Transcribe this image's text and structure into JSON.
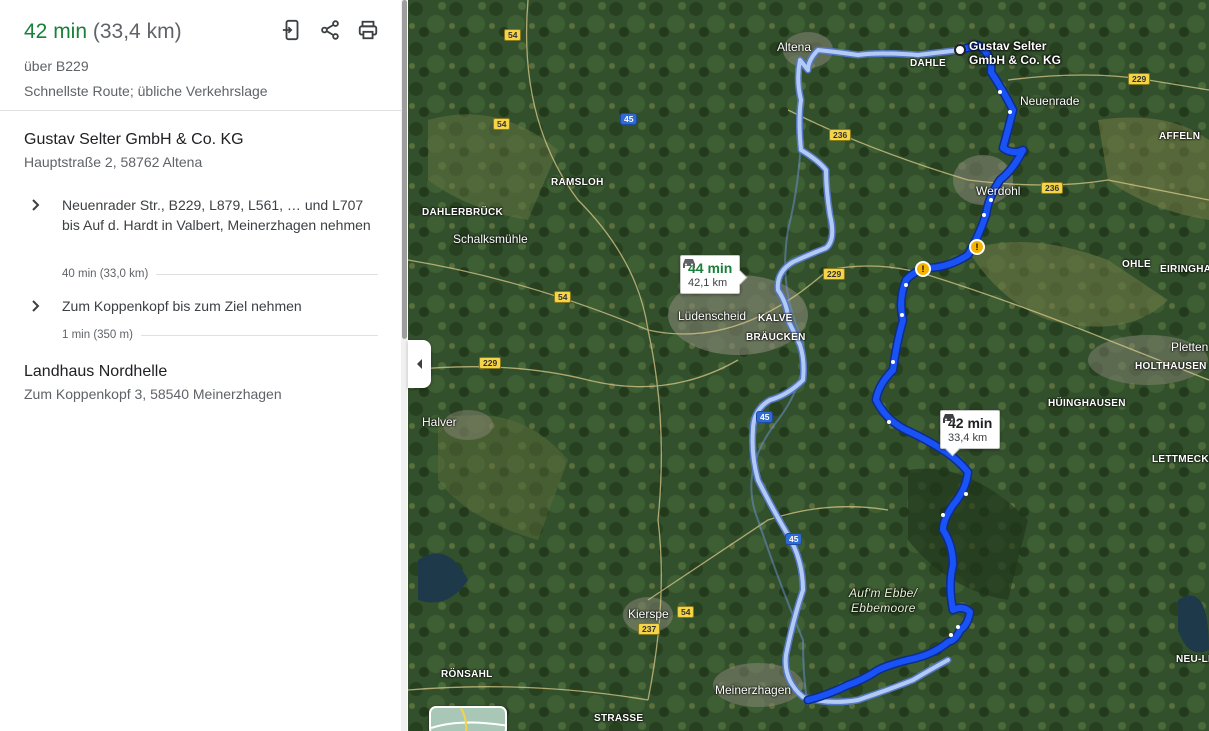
{
  "summary": {
    "duration": "42 min",
    "distance": "(33,4 km)",
    "via": "über B229",
    "note": "Schnellste Route; übliche Verkehrslage",
    "tools": [
      "send-to-phone-icon",
      "share-icon",
      "print-icon"
    ]
  },
  "origin": {
    "name": "Gustav Selter GmbH & Co. KG",
    "address": "Hauptstraße 2, 58762 Altena"
  },
  "steps": [
    {
      "text": "Neuenrader Str., B229, L879, L561, … und L707 bis Auf d. Hardt in Valbert, Meinerzhagen nehmen",
      "meta": "40 min (33,0 km)"
    },
    {
      "text": "Zum Koppenkopf bis zum Ziel nehmen",
      "meta": "1 min (350 m)"
    }
  ],
  "destination": {
    "name": "Landhaus Nordhelle",
    "address": "Zum Koppenkopf 3, 58540 Meinerzhagen"
  },
  "map": {
    "main_route": {
      "time": "42 min",
      "dist": "33,4 km"
    },
    "alt_route": {
      "time": "44 min",
      "dist": "42,1 km"
    },
    "dest_label_line1": "Gustav Selter",
    "dest_label_line2": "GmbH & Co. KG",
    "places": {
      "altena": "Altena",
      "dahle": "DAHLE",
      "neuenrade": "Neuenrade",
      "affeln": "AFFELN",
      "werdohl": "Werdohl",
      "ramsloh": "RAMSLOH",
      "dahlerbruck": "DAHLERBRÜCK",
      "schalksmuehle": "Schalksmühle",
      "ohle": "OHLE",
      "eiringhausen": "EIRINGHA",
      "luedenscheid": "Lüdenscheid",
      "kalve": "KALVE",
      "braecken": "BRÄUCKEN",
      "plettenberg": "Pletten",
      "holthausen": "HOLTHAUSEN",
      "huinghausen": "HÜINGHAUSEN",
      "halver": "Halver",
      "lettmecke": "LETTMECKE",
      "ebbe": "Auf'm Ebbe/",
      "ebbemoore": "Ebbemoore",
      "kierspe": "Kierspe",
      "ronsahl": "RÖNSAHL",
      "neulist": "NEU-LI",
      "meinerzhagen": "Meinerzhagen",
      "strasse": "STRASSE"
    },
    "shields": {
      "b54a": "54",
      "b45a": "45",
      "b54b": "54",
      "b236a": "236",
      "b229a": "229",
      "b236b": "236",
      "b229b": "229",
      "b54c": "54",
      "b229c": "229",
      "b45b": "45",
      "b45c": "45",
      "b54d": "54",
      "b237": "237"
    },
    "colors": {
      "main_route": "#1a53f5",
      "alt_route": "#a8c3f0",
      "duration_green": "#188038"
    }
  }
}
